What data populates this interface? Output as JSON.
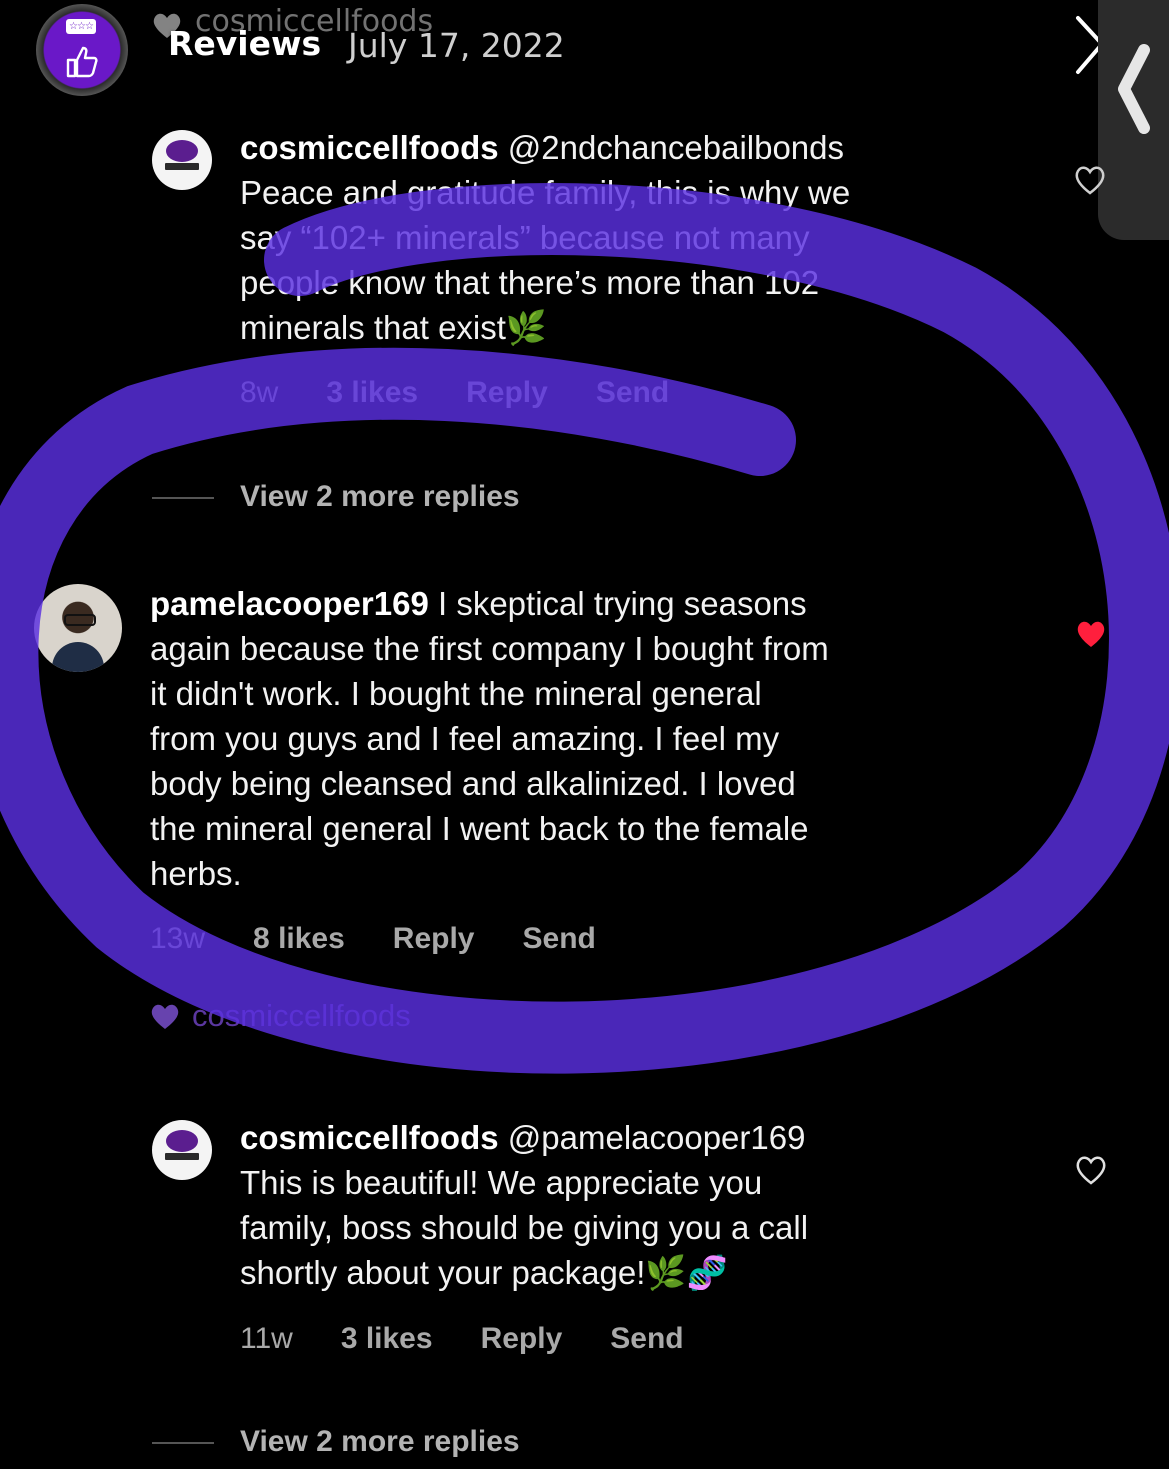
{
  "story": {
    "title": "Reviews",
    "date": "July 17, 2022",
    "ghost_username": "cosmiccellfoods",
    "badge_text": "☆☆☆"
  },
  "comments": [
    {
      "username": "cosmiccellfoods",
      "mention": "@2ndchancebailbonds",
      "text_lines": [
        "Peace and gratitude family, this is why we",
        "say “102+ minerals” because not many",
        "people know that there’s more than 102",
        "minerals that exist🌿"
      ],
      "age": "8w",
      "likes": "3 likes",
      "reply": "Reply",
      "send": "Send",
      "view_more": "View 2 more replies"
    },
    {
      "username": "pamelacooper169",
      "text_lines": [
        "I skeptical trying seasons",
        "again because the first company I bought from",
        "it didn't work. I bought the mineral general",
        "from you guys and I feel amazing. I feel my",
        "body being cleansed and alkalinized. I loved",
        "the mineral general I went back to the female",
        "herbs."
      ],
      "age": "13w",
      "likes": "8 likes",
      "reply": "Reply",
      "send": "Send",
      "liked_by": "cosmiccellfoods"
    },
    {
      "username": "cosmiccellfoods",
      "mention": "@pamelacooper169",
      "text_lines": [
        "This is beautiful! We appreciate you",
        "family, boss should be giving you a call",
        "shortly about your package!🌿🧬"
      ],
      "age": "11w",
      "likes": "3 likes",
      "reply": "Reply",
      "send": "Send",
      "view_more": "View 2 more replies"
    }
  ],
  "colors": {
    "background": "#000000",
    "highlight": "#5a2fe0",
    "liked_heart": "#ff1f3d",
    "brand_purple": "#6a18c8"
  }
}
